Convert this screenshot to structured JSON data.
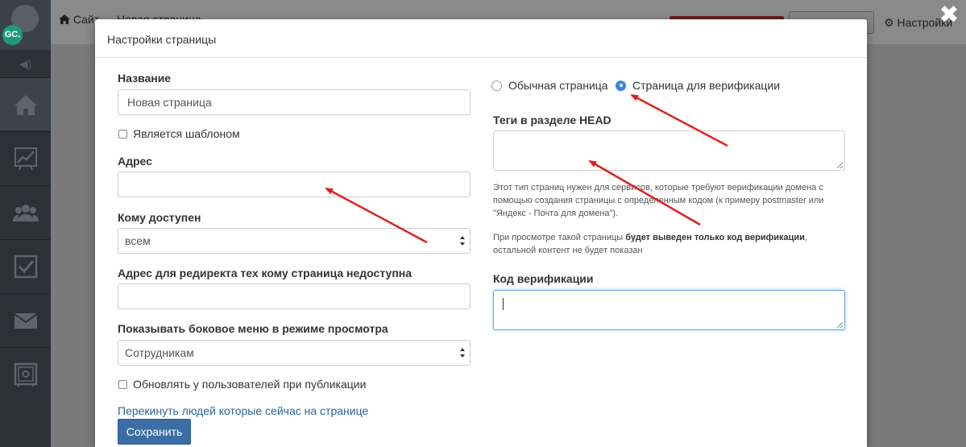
{
  "sidebar": {
    "avatar_initials": "GC.",
    "items": [
      {
        "name": "home",
        "active": true
      },
      {
        "name": "chart",
        "active": false
      },
      {
        "name": "users",
        "active": false
      },
      {
        "name": "tasks",
        "active": false
      },
      {
        "name": "mail",
        "active": false
      },
      {
        "name": "safe",
        "active": false
      }
    ]
  },
  "topbar": {
    "crumb_site": "Сайт",
    "crumb_sep": "→",
    "crumb_page": "Новая страница",
    "settings_label": "Настройки"
  },
  "modal": {
    "title": "Настройки страницы",
    "close_glyph": "✖",
    "left": {
      "name_label": "Название",
      "name_value": "Новая страница",
      "is_template_label": "Является шаблоном",
      "address_label": "Адрес",
      "address_value": "",
      "access_label": "Кому доступен",
      "access_value": "всем",
      "redirect_label": "Адрес для редиректа тех кому страница недоступна",
      "redirect_value": "",
      "sidebar_menu_label": "Показывать боковое меню в режиме просмотра",
      "sidebar_menu_value": "Сотрудникам",
      "update_users_label": "Обновлять у пользователей при публикации",
      "move_people_link": "Перекинуть людей которые сейчас на странице",
      "save_button": "Сохранить"
    },
    "right": {
      "radio_normal": "Обычная страница",
      "radio_verification": "Страница для верификации",
      "selected_type": "verification",
      "head_tags_label": "Теги в разделе HEAD",
      "help_1": "Этот тип страниц нужен для сервисов, которые требуют верификации домена с помощью создания страницы с определенным кодом (к примеру postmaster или \"Яндекс - Почта для домена\").",
      "help_2_prefix": "При просмотре такой страницы ",
      "help_2_bold": "будет выведен только код верификации",
      "help_2_suffix": ", остальной контент не будет показан",
      "verification_code_label": "Код верификации"
    }
  },
  "colors": {
    "primary_button": "#3b6ea5",
    "link": "#2a6496",
    "radio_checked": "#3a84e6",
    "annotation_arrow": "#e0201e",
    "sidebar_bg": "#2b3137",
    "avatar_bg": "#1f9a7c"
  }
}
